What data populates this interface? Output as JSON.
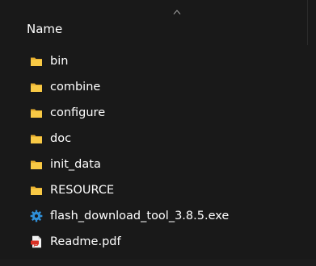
{
  "header": {
    "column_name": "Name"
  },
  "files": [
    {
      "name": "bin",
      "type": "folder",
      "icon": "folder-icon"
    },
    {
      "name": "combine",
      "type": "folder",
      "icon": "folder-icon"
    },
    {
      "name": "configure",
      "type": "folder",
      "icon": "folder-icon"
    },
    {
      "name": "doc",
      "type": "folder",
      "icon": "folder-icon"
    },
    {
      "name": "init_data",
      "type": "folder",
      "icon": "folder-icon"
    },
    {
      "name": "RESOURCE",
      "type": "folder",
      "icon": "folder-icon"
    },
    {
      "name": "flash_download_tool_3.8.5.exe",
      "type": "exe",
      "icon": "gear-app-icon"
    },
    {
      "name": "Readme.pdf",
      "type": "pdf",
      "icon": "pdf-icon"
    }
  ],
  "colors": {
    "background": "#191919",
    "folder": "#f5c542",
    "exe_icon": "#2f8fd8",
    "pdf_icon": "#d93025",
    "text": "#ffffff"
  }
}
